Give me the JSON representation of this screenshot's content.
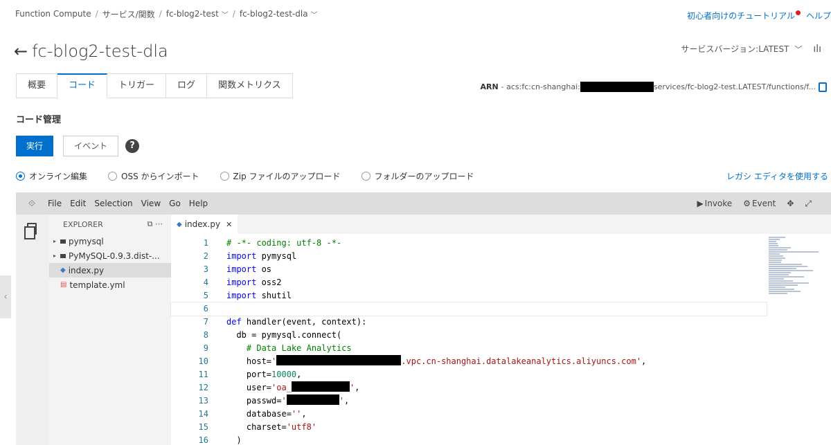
{
  "breadcrumb": {
    "items": [
      "Function Compute",
      "サービス/関数",
      "fc-blog2-test",
      "fc-blog2-test-dla"
    ],
    "separator": "/"
  },
  "header": {
    "tutorial": "初心者向けのチュートリアル",
    "help": "ヘルプ",
    "title": "fc-blog2-test-dla",
    "version": "サービスバージョン:LATEST"
  },
  "tabs": [
    {
      "label": "概要"
    },
    {
      "label": "コード"
    },
    {
      "label": "トリガー"
    },
    {
      "label": "ログ"
    },
    {
      "label": "関数メトリクス"
    }
  ],
  "arn": {
    "label": "ARN",
    "prefix": "- acs:fc:cn-shanghai:",
    "suffix": "services/fc-blog2-test.LATEST/functions/f..."
  },
  "code_section": {
    "title": "コード管理",
    "run_button": "実行",
    "event_button": "イベント",
    "help": "?"
  },
  "source_options": {
    "online": "オンライン編集",
    "oss": "OSS からインポート",
    "zip": "Zip ファイルのアップロード",
    "folder": "フォルダーのアップロード",
    "legacy": "レガシ エディタを使用する"
  },
  "ide": {
    "menu": [
      "File",
      "Edit",
      "Selection",
      "View",
      "Go",
      "Help"
    ],
    "invoke": "Invoke",
    "event": "Event",
    "explorer_title": "EXPLORER",
    "tree": [
      {
        "name": "pymysql",
        "type": "folder"
      },
      {
        "name": "PyMySQL-0.9.3.dist-...",
        "type": "folder"
      },
      {
        "name": "index.py",
        "type": "py"
      },
      {
        "name": "template.yml",
        "type": "yml"
      }
    ],
    "open_tab": "index.py",
    "code_lines": {
      "l1": "# -*- coding: utf-8 -*-",
      "l2_kw": "import",
      "l2_rest": " pymysql",
      "l3_kw": "import",
      "l3_rest": " os",
      "l4_kw": "import",
      "l4_rest": " oss2",
      "l5_kw": "import",
      "l5_rest": " shutil",
      "l7_kw": "def",
      "l7_rest": " handler(event, context):",
      "l8": "  db = pymysql.connect(",
      "l9": "    # Data Lake Analytics",
      "l10_a": "    host=",
      "l10_q": "'",
      "l10_b": ".vpc.cn-shanghai.datalakeanalytics.aliyuncs.com'",
      "l10_c": ",",
      "l11_a": "    port=",
      "l11_b": "10000",
      "l11_c": ",",
      "l12_a": "    user=",
      "l12_b": "'oa_",
      "l12_c": "'",
      "l12_d": ",",
      "l13_a": "    passwd=",
      "l13_b": "'",
      "l13_c": "'",
      "l13_d": ",",
      "l14_a": "    database=",
      "l14_b": "''",
      "l14_c": ",",
      "l15_a": "    charset=",
      "l15_b": "'utf8'",
      "l16": "  )"
    },
    "line_numbers": [
      "1",
      "2",
      "3",
      "4",
      "5",
      "6",
      "7",
      "8",
      "9",
      "10",
      "11",
      "12",
      "13",
      "14",
      "15",
      "16"
    ]
  },
  "colors": {
    "accent": "#0070cc",
    "keyword": "#0000ff",
    "comment": "#008000",
    "string": "#a31515",
    "number": "#098658"
  }
}
